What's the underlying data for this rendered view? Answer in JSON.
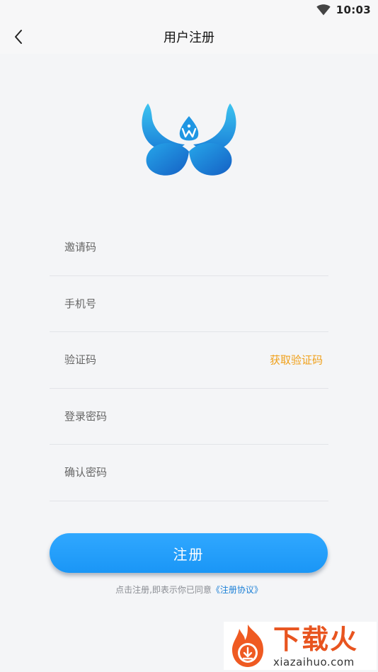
{
  "status_bar": {
    "time": "10:03"
  },
  "nav": {
    "title": "用户注册"
  },
  "form": {
    "invite_placeholder": "邀请码",
    "phone_placeholder": "手机号",
    "code_placeholder": "验证码",
    "get_code_label": "获取验证码",
    "password_placeholder": "登录密码",
    "confirm_placeholder": "确认密码"
  },
  "register_label": "注册",
  "agreement": {
    "prefix": "点击注册,即表示你已同意",
    "link": "《注册协议》"
  },
  "watermark": {
    "title": "下载火",
    "url": "xiazaihuo.com"
  },
  "colors": {
    "accent": "#1a96f6",
    "link": "#1a7fd6",
    "warning": "#f0a019",
    "watermark": "#e8541f"
  }
}
